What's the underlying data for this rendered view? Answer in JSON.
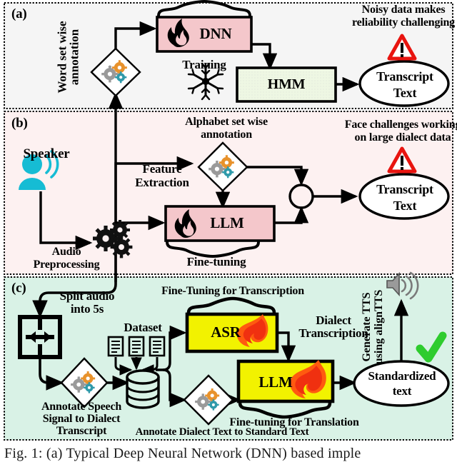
{
  "figure": {
    "caption": "Fig. 1: (a) Typical Deep Neural Network (DNN) based imple"
  },
  "panels": {
    "a": {
      "tag": "(a)",
      "bg": "#f5f5f5",
      "labels": {
        "word_set_annotation": "Word set wise\nannotation",
        "training": "Training",
        "dnn": "DNN",
        "hmm": "HMM",
        "transcript_text": "Transcript\nText",
        "warning": "Noisy data makes\nreliability challenging"
      },
      "icons": {
        "gear_diamond": "gears-diamond-icon",
        "fire": "fire-icon",
        "snowflake": "snowflake-icon",
        "warning": "warning-triangle-icon"
      }
    },
    "b": {
      "tag": "(b)",
      "bg": "#fdf1f1",
      "labels": {
        "speaker": "Speaker",
        "audio_preprocessing": "Audio\nPreprocessing",
        "feature_extraction": "Feature\nExtraction",
        "alphabet_annotation": "Alphabet set wise\nannotation",
        "llm": "LLM",
        "fine_tuning": "Fine-tuning",
        "transcript_text": "Transcript\nText",
        "warning": "Face challenges working\non large dialect data"
      },
      "icons": {
        "speaker": "speaker-person-icon",
        "gears": "gears-cluster-icon",
        "gear_diamond": "gears-diamond-icon",
        "fire": "fire-icon",
        "merge": "merge-circle-icon",
        "warning": "warning-triangle-icon"
      }
    },
    "c": {
      "tag": "(c)",
      "bg": "#d9f2e6",
      "labels": {
        "split_audio": "Split audio\ninto 5s",
        "annotate_speech": "Annotate Speech\nSignal to Dialect\nTranscript",
        "dataset": "Dataset",
        "annotate_dialect": "Annotate Dialect Text to Standard Text",
        "fine_tuning_transcription": "Fine-Tuning for Transcription",
        "asr": "ASR",
        "dialect_transcription": "Dialect\nTranscription",
        "llm": "LLM",
        "fine_tuning_translation": "Fine-tuning for Translation",
        "standardized_text": "Standardized\ntext",
        "generate_tts": "Generate TTS\nusing alignTTS"
      },
      "icons": {
        "split": "split-audio-icon",
        "gear_diamond": "gears-diamond-icon",
        "documents": "documents-icon",
        "database": "database-cylinder-icon",
        "fire": "fire-icon",
        "tts_speaker": "tts-speaker-icon",
        "check": "check-mark-icon"
      }
    }
  },
  "colors": {
    "panel_a_bg": "#f5f5f5",
    "panel_b_bg": "#fdf1f1",
    "panel_c_bg": "#d9f2e6",
    "pink_box": "#f4c7cb",
    "green_box": "#eef7e3",
    "yellow_box": "#f2f200",
    "gear_orange": "#e8922c",
    "gear_gray": "#9a9a9a",
    "gear_teal": "#2f9aaa",
    "speaker_cyan": "#16bcd4",
    "warning_red": "#e8140f",
    "check_green": "#2ecc2e",
    "flame_orange": "#ff5a10",
    "flame_red": "#f03010"
  }
}
